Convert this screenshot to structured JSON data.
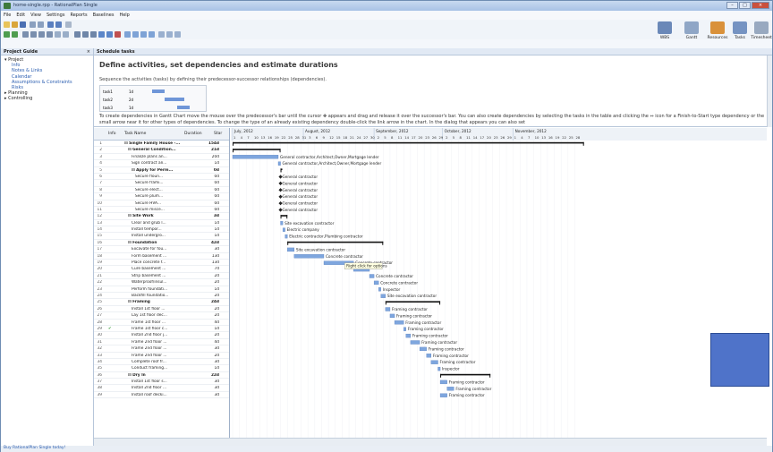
{
  "window": {
    "title": "home-single.rpp - RationalPlan Single",
    "buttons": [
      "–",
      "□",
      "×"
    ]
  },
  "menu": [
    "File",
    "Edit",
    "View",
    "Settings",
    "Reports",
    "Baselines",
    "Help"
  ],
  "right_toolbar": [
    "WBS",
    "Gantt",
    "Resources",
    "Tasks",
    "Timesheet"
  ],
  "project_guide": {
    "title": "Project Guide",
    "close": "×",
    "items": [
      {
        "label": "Project",
        "level": 0,
        "link": false
      },
      {
        "label": "Info",
        "level": 1,
        "link": true
      },
      {
        "label": "Notes & Links",
        "level": 1,
        "link": true
      },
      {
        "label": "Calendar",
        "level": 1,
        "link": true
      },
      {
        "label": "Assumptions & Constraints",
        "level": 1,
        "link": true
      },
      {
        "label": "Risks",
        "level": 1,
        "link": true
      },
      {
        "label": "Planning",
        "level": 0,
        "link": false
      },
      {
        "label": "Controlling",
        "level": 0,
        "link": false
      }
    ]
  },
  "schedule": {
    "title": "Schedule tasks",
    "heading": "Define activities, set dependencies and estimate durations",
    "intro": "Sequence the activities (tasks) by defining their predecessor-successor relationships (dependencies).",
    "mini_rows": [
      {
        "name": "task1",
        "dur": "1d"
      },
      {
        "name": "task2",
        "dur": "2d"
      },
      {
        "name": "task3",
        "dur": "1d"
      }
    ],
    "para": "To create dependencies in Gantt Chart move the mouse over the predecessor's bar until the cursor ✥ appears and drag and release it over the successor's bar. You can also create dependencies by selecting the tasks in the table and clicking the ⇔ icon for a Finish-to-Start type dependency or the small arrow near it for other types of dependencies. To change the type of an already existing dependency double-click the link arrow in the chart. In the dialog that appears you can also set"
  },
  "table": {
    "headers": {
      "info": "Info",
      "name": "Task Name",
      "duration": "Duration",
      "start": "Star"
    },
    "rows": [
      {
        "n": "1",
        "name": "Single Family House -...",
        "dur": "154d",
        "level": 0,
        "summary": true
      },
      {
        "n": "2",
        "name": "General Condition...",
        "dur": "21d",
        "level": 1,
        "summary": true
      },
      {
        "n": "3",
        "name": "Finalize plans an...",
        "dur": "20d",
        "level": 2,
        "summary": false
      },
      {
        "n": "4",
        "name": "Sign contract an...",
        "dur": "1d",
        "level": 2,
        "summary": false
      },
      {
        "n": "5",
        "name": "Apply for Perm...",
        "dur": "0d",
        "level": 2,
        "summary": true
      },
      {
        "n": "6",
        "name": "Secure floun...",
        "dur": "0d",
        "level": 3,
        "summary": false
      },
      {
        "n": "7",
        "name": "Secure frami...",
        "dur": "0d",
        "level": 3,
        "summary": false
      },
      {
        "n": "8",
        "name": "Secure elect...",
        "dur": "0d",
        "level": 3,
        "summary": false
      },
      {
        "n": "9",
        "name": "Secure plum...",
        "dur": "0d",
        "level": 3,
        "summary": false
      },
      {
        "n": "10",
        "name": "Secure HVA...",
        "dur": "0d",
        "level": 3,
        "summary": false
      },
      {
        "n": "11",
        "name": "Secure misce...",
        "dur": "0d",
        "level": 3,
        "summary": false
      },
      {
        "n": "12",
        "name": "Site Work",
        "dur": "3d",
        "level": 1,
        "summary": true
      },
      {
        "n": "13",
        "name": "Clear and grub l...",
        "dur": "1d",
        "level": 2,
        "summary": false
      },
      {
        "n": "14",
        "name": "Install tempor...",
        "dur": "1d",
        "level": 2,
        "summary": false
      },
      {
        "n": "15",
        "name": "Install undergro...",
        "dur": "1d",
        "level": 2,
        "summary": false
      },
      {
        "n": "16",
        "name": "Foundation",
        "dur": "42d",
        "level": 1,
        "summary": true
      },
      {
        "n": "17",
        "name": "Excavate for fou...",
        "dur": "3d",
        "level": 2,
        "summary": false
      },
      {
        "n": "18",
        "name": "Form basement ...",
        "dur": "13d",
        "level": 2,
        "summary": false
      },
      {
        "n": "19",
        "name": "Place concrete f...",
        "dur": "13d",
        "level": 2,
        "summary": false
      },
      {
        "n": "20",
        "name": "Cure basement ...",
        "dur": "7d",
        "level": 2,
        "summary": false
      },
      {
        "n": "21",
        "name": "Strip basement ...",
        "dur": "2d",
        "level": 2,
        "summary": false
      },
      {
        "n": "22",
        "name": "Waterproof/insul...",
        "dur": "2d",
        "level": 2,
        "summary": false
      },
      {
        "n": "23",
        "name": "Perform foundati...",
        "dur": "1d",
        "level": 2,
        "summary": false
      },
      {
        "n": "24",
        "name": "Backfill foundatio...",
        "dur": "2d",
        "level": 2,
        "summary": false
      },
      {
        "n": "25",
        "name": "Framing",
        "dur": "24d",
        "level": 1,
        "summary": true
      },
      {
        "n": "26",
        "name": "Install 1st floor ...",
        "dur": "2d",
        "level": 2,
        "summary": false
      },
      {
        "n": "27",
        "name": "Lay 1st floor dec...",
        "dur": "2d",
        "level": 2,
        "summary": false
      },
      {
        "n": "28",
        "name": "Frame 1st floor ...",
        "dur": "4d",
        "level": 2,
        "summary": false
      },
      {
        "n": "29",
        "name": "Frame 1st floor c...",
        "dur": "1d",
        "level": 2,
        "summary": false,
        "check": true
      },
      {
        "n": "30",
        "name": "Install 2nd floor j...",
        "dur": "2d",
        "level": 2,
        "summary": false
      },
      {
        "n": "31",
        "name": "Frame 2nd floor ...",
        "dur": "4d",
        "level": 2,
        "summary": false
      },
      {
        "n": "32",
        "name": "Frame 2nd floor ...",
        "dur": "3d",
        "level": 2,
        "summary": false
      },
      {
        "n": "33",
        "name": "Frame 2nd floor ...",
        "dur": "2d",
        "level": 2,
        "summary": false
      },
      {
        "n": "34",
        "name": "Complete roof fr...",
        "dur": "3d",
        "level": 2,
        "summary": false
      },
      {
        "n": "35",
        "name": "Conduct framing...",
        "dur": "1d",
        "level": 2,
        "summary": false
      },
      {
        "n": "36",
        "name": "Dry In",
        "dur": "22d",
        "level": 1,
        "summary": true
      },
      {
        "n": "37",
        "name": "Install 1st floor s...",
        "dur": "3d",
        "level": 2,
        "summary": false
      },
      {
        "n": "38",
        "name": "Install 2nd floor ...",
        "dur": "3d",
        "level": 2,
        "summary": false
      },
      {
        "n": "39",
        "name": "Install roof decki...",
        "dur": "3d",
        "level": 2,
        "summary": false
      }
    ]
  },
  "gantt": {
    "months": [
      "July, 2012",
      "August, 2012",
      "September, 2012",
      "October, 2012",
      "November, 2012"
    ],
    "days": [
      "1",
      "4",
      "7",
      "10",
      "13",
      "16",
      "19",
      "22",
      "25",
      "28",
      "31",
      "3",
      "6",
      "9",
      "12",
      "15",
      "18",
      "21",
      "24",
      "27",
      "30",
      "2",
      "5",
      "8",
      "11",
      "14",
      "17",
      "20",
      "23",
      "26",
      "29",
      "2",
      "5",
      "8",
      "11",
      "14",
      "17",
      "20",
      "23",
      "26",
      "29",
      "1",
      "4",
      "7",
      "10",
      "13",
      "16",
      "19",
      "22",
      "25",
      "28"
    ],
    "tooltip": "Right click for options",
    "bars": [
      {
        "row": 1,
        "start": 0,
        "end": 154,
        "summary": true
      },
      {
        "row": 2,
        "start": 0,
        "end": 21,
        "summary": true
      },
      {
        "row": 3,
        "start": 0,
        "end": 20,
        "label": "General contractor,Architect,Owner,Mortgage lender"
      },
      {
        "row": 4,
        "start": 20,
        "end": 21,
        "label": "General contractor,Architect,Owner,Mortgage lender"
      },
      {
        "row": 5,
        "start": 21,
        "end": 21,
        "summary": true
      },
      {
        "row": 6,
        "start": 21,
        "end": 21,
        "milestone": true,
        "label": "General contractor"
      },
      {
        "row": 7,
        "start": 21,
        "end": 21,
        "milestone": true,
        "label": "General contractor"
      },
      {
        "row": 8,
        "start": 21,
        "end": 21,
        "milestone": true,
        "label": "General contractor"
      },
      {
        "row": 9,
        "start": 21,
        "end": 21,
        "milestone": true,
        "label": "General contractor"
      },
      {
        "row": 10,
        "start": 21,
        "end": 21,
        "milestone": true,
        "label": "General contractor"
      },
      {
        "row": 11,
        "start": 21,
        "end": 21,
        "milestone": true,
        "label": "General contractor"
      },
      {
        "row": 12,
        "start": 21,
        "end": 24,
        "summary": true
      },
      {
        "row": 13,
        "start": 21,
        "end": 22,
        "label": "Site excavation contractor"
      },
      {
        "row": 14,
        "start": 22,
        "end": 23,
        "label": "Electric company"
      },
      {
        "row": 15,
        "start": 23,
        "end": 24,
        "label": "Electric contractor,Plumbing contractor"
      },
      {
        "row": 16,
        "start": 24,
        "end": 66,
        "summary": true
      },
      {
        "row": 17,
        "start": 24,
        "end": 27,
        "label": "Site excavation contractor"
      },
      {
        "row": 18,
        "start": 27,
        "end": 40,
        "label": "Concrete contractor"
      },
      {
        "row": 19,
        "start": 40,
        "end": 53,
        "label": "Concrete contractor"
      },
      {
        "row": 20,
        "start": 53,
        "end": 60
      },
      {
        "row": 21,
        "start": 60,
        "end": 62,
        "label": "Concrete contractor"
      },
      {
        "row": 22,
        "start": 62,
        "end": 64,
        "label": "Concrete contractor"
      },
      {
        "row": 23,
        "start": 64,
        "end": 65,
        "label": "Inspector"
      },
      {
        "row": 24,
        "start": 65,
        "end": 67,
        "label": "Site excavation contractor"
      },
      {
        "row": 25,
        "start": 67,
        "end": 91,
        "summary": true
      },
      {
        "row": 26,
        "start": 67,
        "end": 69,
        "label": "Framing contractor"
      },
      {
        "row": 27,
        "start": 69,
        "end": 71,
        "label": "Framing contractor"
      },
      {
        "row": 28,
        "start": 71,
        "end": 75,
        "label": "Framing contractor"
      },
      {
        "row": 29,
        "start": 75,
        "end": 76,
        "label": "Framing contractor"
      },
      {
        "row": 30,
        "start": 76,
        "end": 78,
        "label": "Framing contractor"
      },
      {
        "row": 31,
        "start": 78,
        "end": 82,
        "label": "Framing contractor"
      },
      {
        "row": 32,
        "start": 82,
        "end": 85,
        "label": "Framing contractor"
      },
      {
        "row": 33,
        "start": 85,
        "end": 87,
        "label": "Framing contractor"
      },
      {
        "row": 34,
        "start": 87,
        "end": 90,
        "label": "Framing contractor"
      },
      {
        "row": 35,
        "start": 90,
        "end": 91,
        "label": "Inspector"
      },
      {
        "row": 36,
        "start": 91,
        "end": 113,
        "summary": true
      },
      {
        "row": 37,
        "start": 91,
        "end": 94,
        "label": "Framing contractor"
      },
      {
        "row": 38,
        "start": 94,
        "end": 97,
        "label": "Framing contractor"
      },
      {
        "row": 39,
        "start": 91,
        "end": 94,
        "label": "Framing contractor"
      }
    ]
  },
  "status": "Buy RationalPlan Single today!"
}
